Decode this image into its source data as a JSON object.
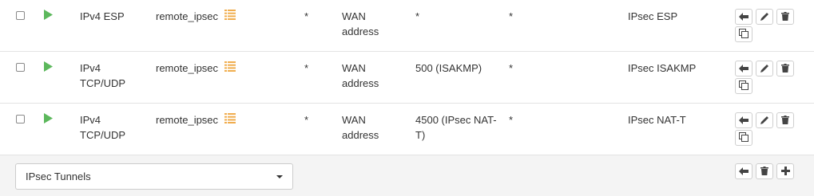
{
  "rules": [
    {
      "protocol": "IPv4 ESP",
      "source": "remote_ipsec",
      "source_port": "*",
      "destination": "WAN address",
      "destination_port": "*",
      "gateway": "*",
      "description": "IPsec ESP"
    },
    {
      "protocol": "IPv4 TCP/UDP",
      "source": "remote_ipsec",
      "source_port": "*",
      "destination": "WAN address",
      "destination_port": "500 (ISAKMP)",
      "gateway": "*",
      "description": "IPsec ISAKMP"
    },
    {
      "protocol": "IPv4 TCP/UDP",
      "source": "remote_ipsec",
      "source_port": "*",
      "destination": "WAN address",
      "destination_port": "4500 (IPsec NAT-T)",
      "gateway": "*",
      "description": "IPsec NAT-T"
    }
  ],
  "footer": {
    "selected_interface": "IPsec Tunnels"
  },
  "icons": {
    "status": "play-icon",
    "alias": "list-icon",
    "move": "arrow-left-icon",
    "edit": "pencil-icon",
    "delete": "trash-icon",
    "copy": "clone-icon",
    "add": "plus-icon"
  },
  "colors": {
    "pass_green": "#5cb85c",
    "alias_orange": "#f0ad4e",
    "footer_bg": "#f4f4f4",
    "border": "#e3e3e3"
  }
}
